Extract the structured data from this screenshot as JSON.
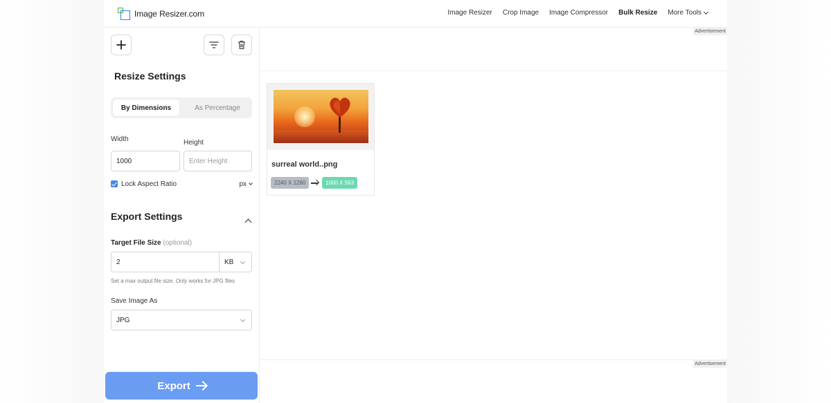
{
  "header": {
    "logo_text": "Image Resizer.com",
    "nav": [
      "Image Resizer",
      "Crop Image",
      "Image Compressor",
      "Bulk Resize",
      "More Tools"
    ],
    "active_nav": "Bulk Resize"
  },
  "sidebar": {
    "resize_settings_title": "Resize Settings",
    "tabs": [
      "By Dimensions",
      "As Percentage"
    ],
    "selected_tab": "By Dimensions",
    "width_label": "Width",
    "height_label": "Height",
    "width_value": "1000",
    "height_placeholder": "Enter Height",
    "lock_aspect_label": "Lock Aspect Ratio",
    "lock_aspect_checked": true,
    "unit": "px",
    "export_settings_title": "Export Settings",
    "target_size_label": "Target File Size",
    "target_size_optional": "(optional)",
    "target_size_value": "2",
    "target_size_unit": "KB",
    "target_size_hint": "Set a max output file size. Only works for JPG files",
    "save_as_label": "Save Image As",
    "save_as_value": "JPG",
    "export_button": "Export"
  },
  "main": {
    "ad_label": "Advertisement",
    "image_card": {
      "file_name": "surreal world..png",
      "original_size": "2240 X 1260",
      "new_size": "1000 X 563"
    }
  },
  "colors": {
    "accent": "#6a9cf2",
    "checkbox": "#4a86e8",
    "new_size_badge": "#6cd9b0",
    "old_size_badge": "#b5bcc6"
  }
}
